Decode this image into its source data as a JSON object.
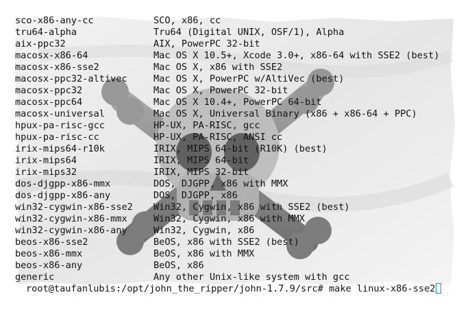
{
  "terminal": {
    "targets": [
      {
        "name": "sco-x86-any-cc",
        "description": "SCO, x86, cc"
      },
      {
        "name": "tru64-alpha",
        "description": "Tru64 (Digital UNIX, OSF/1), Alpha"
      },
      {
        "name": "aix-ppc32",
        "description": "AIX, PowerPC 32-bit"
      },
      {
        "name": "macosx-x86-64",
        "description": "Mac OS X 10.5+, Xcode 3.0+, x86-64 with SSE2 (best)"
      },
      {
        "name": "macosx-x86-sse2",
        "description": "Mac OS X, x86 with SSE2"
      },
      {
        "name": "macosx-ppc32-altivec",
        "description": "Mac OS X, PowerPC w/AltiVec (best)"
      },
      {
        "name": "macosx-ppc32",
        "description": "Mac OS X, PowerPC 32-bit"
      },
      {
        "name": "macosx-ppc64",
        "description": "Mac OS X 10.4+, PowerPC 64-bit"
      },
      {
        "name": "macosx-universal",
        "description": "Mac OS X, Universal Binary (x86 + x86-64 + PPC)"
      },
      {
        "name": "hpux-pa-risc-gcc",
        "description": "HP-UX, PA-RISC, gcc"
      },
      {
        "name": "hpux-pa-risc-cc",
        "description": "HP-UX, PA-RISC, ANSI cc"
      },
      {
        "name": "irix-mips64-r10k",
        "description": "IRIX, MIPS 64-bit (R10K) (best)"
      },
      {
        "name": "irix-mips64",
        "description": "IRIX, MIPS 64-bit"
      },
      {
        "name": "irix-mips32",
        "description": "IRIX, MIPS 32-bit"
      },
      {
        "name": "dos-djgpp-x86-mmx",
        "description": "DOS, DJGPP, x86 with MMX"
      },
      {
        "name": "dos-djgpp-x86-any",
        "description": "DOS, DJGPP, x86"
      },
      {
        "name": "win32-cygwin-x86-sse2",
        "description": "Win32, Cygwin, x86 with SSE2 (best)"
      },
      {
        "name": "win32-cygwin-x86-mmx",
        "description": "Win32, Cygwin, x86 with MMX"
      },
      {
        "name": "win32-cygwin-x86-any",
        "description": "Win32, Cygwin, x86"
      },
      {
        "name": "beos-x86-sse2",
        "description": "BeOS, x86 with SSE2 (best)"
      },
      {
        "name": "beos-x86-mmx",
        "description": "BeOS, x86 with MMX"
      },
      {
        "name": "beos-x86-any",
        "description": "BeOS, x86"
      },
      {
        "name": "generic",
        "description": "Any other Unix-like system with gcc"
      }
    ],
    "prompt": "root@taufanlubis:/opt/john_the_ripper/john-1.7.9/src# ",
    "command": "make linux-x86-sse2"
  },
  "colors": {
    "background": "#ffffff",
    "text": "#111111",
    "watermark": "#7a7a7a",
    "cursor": "#2a8fa8"
  },
  "icons": {
    "watermark": "skull-crossbones-icon"
  }
}
